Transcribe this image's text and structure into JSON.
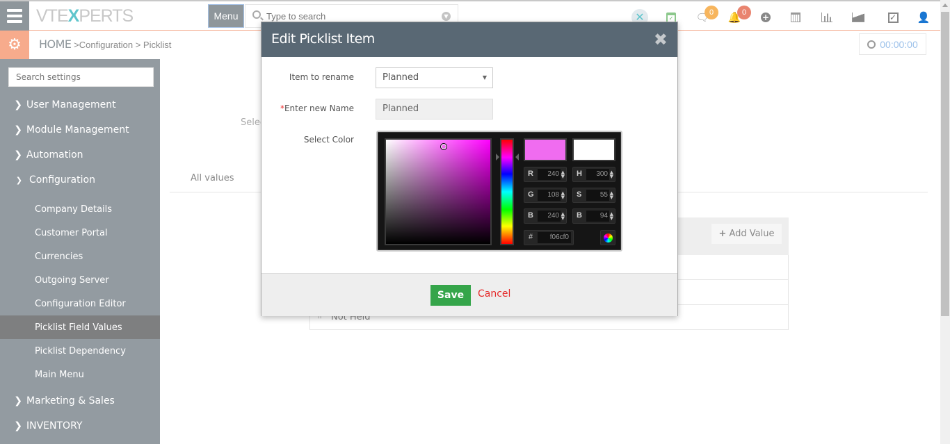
{
  "topbar": {
    "logo_left": "VTE",
    "logo_x": "X",
    "logo_right": "PERTS",
    "menu_label": "Menu",
    "search_placeholder": "Type to search",
    "icons": [
      {
        "name": "vtexperts-x-icon",
        "glyph": "✕"
      },
      {
        "name": "calendar-check-icon",
        "glyph": "📅"
      },
      {
        "name": "chat-icon",
        "glyph": "💬",
        "badge": "0",
        "badge_color": "#f7b55d"
      },
      {
        "name": "bell-icon",
        "glyph": "🔔",
        "badge": "0",
        "badge_color": "#e9846f"
      },
      {
        "name": "plus-circle-icon",
        "glyph": "⊕"
      },
      {
        "name": "calendar-icon",
        "glyph": "▦"
      },
      {
        "name": "bar-chart-icon",
        "glyph": "📊"
      },
      {
        "name": "area-chart-icon",
        "glyph": "◭"
      },
      {
        "name": "checkbox-icon",
        "glyph": "☑"
      },
      {
        "name": "user-icon",
        "glyph": "👤"
      }
    ]
  },
  "breadcrumb": {
    "home": "HOME",
    "sep1": " >",
    "item1": "Configuration",
    "sep2": " > ",
    "item2": "Picklist"
  },
  "timer": "00:00:00",
  "sidebar": {
    "search_placeholder": "Search settings",
    "sections": [
      {
        "label": "User Management",
        "chevron": "›",
        "expanded": false
      },
      {
        "label": "Module Management",
        "chevron": "›",
        "expanded": false
      },
      {
        "label": "Automation",
        "chevron": "›",
        "expanded": false
      },
      {
        "label": "Configuration",
        "chevron": "⌄",
        "expanded": true
      },
      {
        "label": "Marketing & Sales",
        "chevron": "›",
        "expanded": false
      },
      {
        "label": "INVENTORY",
        "chevron": "›",
        "expanded": false
      }
    ],
    "config_items": [
      {
        "label": "Company Details",
        "active": false
      },
      {
        "label": "Customer Portal",
        "active": false
      },
      {
        "label": "Currencies",
        "active": false
      },
      {
        "label": "Outgoing Server",
        "active": false
      },
      {
        "label": "Configuration Editor",
        "active": false
      },
      {
        "label": "Picklist Field Values",
        "active": true
      },
      {
        "label": "Picklist Dependency",
        "active": false
      },
      {
        "label": "Main Menu",
        "active": false
      }
    ]
  },
  "main": {
    "select_label_partial": "Selec",
    "tab_all_values": "All values",
    "add_value_label": "Add Value",
    "rows": [
      "",
      "",
      "Not Held"
    ]
  },
  "modal": {
    "title": "Edit Picklist Item",
    "item_to_rename_label": "Item to rename",
    "item_to_rename_value": "Planned",
    "new_name_required": "*",
    "new_name_label": "Enter new Name",
    "new_name_value": "Planned",
    "select_color_label": "Select Color",
    "color": {
      "new_color": "#f06cf0",
      "old_color": "#ffffff",
      "r": "240",
      "g": "108",
      "b": "240",
      "h": "300",
      "s": "55",
      "bri": "94",
      "hex": "f06cf0"
    },
    "save_label": "Save",
    "cancel_label": "Cancel"
  }
}
